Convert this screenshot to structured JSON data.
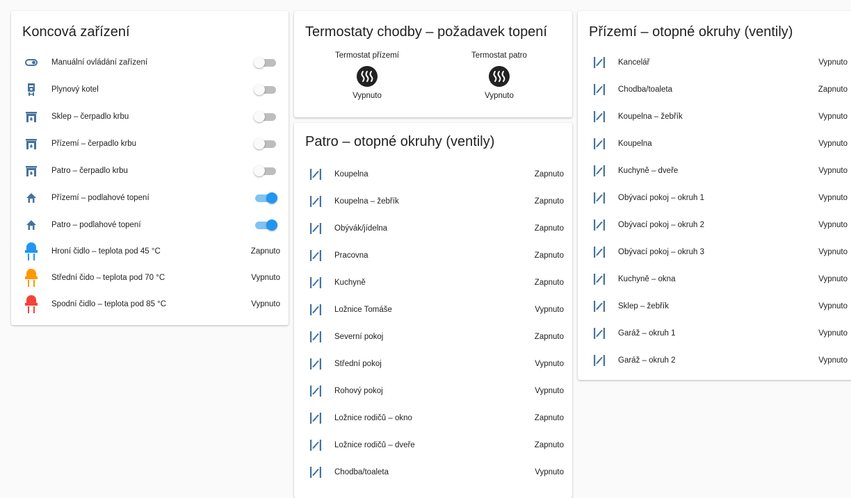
{
  "colors": {
    "icon_blue": "#44739e",
    "toggle_on": "#2196f3",
    "sensor_blue": "#2196f3",
    "sensor_orange": "#ff9800",
    "sensor_red": "#f44336"
  },
  "devices": {
    "title": "Koncová zařízení",
    "items": [
      {
        "label": "Manuální ovládání zařízení",
        "icon": "toggle-switch-icon",
        "type": "toggle",
        "on": false
      },
      {
        "label": "Plynový kotel",
        "icon": "boiler-icon",
        "type": "toggle",
        "on": false
      },
      {
        "label": "Sklep – čerpadlo krbu",
        "icon": "fireplace-icon",
        "type": "toggle",
        "on": false
      },
      {
        "label": "Přízemí – čerpadlo krbu",
        "icon": "fireplace-icon",
        "type": "toggle",
        "on": false
      },
      {
        "label": "Patro – čerpadlo krbu",
        "icon": "fireplace-icon",
        "type": "toggle",
        "on": false
      },
      {
        "label": "Přízemí – podlahové topení",
        "icon": "home-floor-icon",
        "type": "toggle",
        "on": true
      },
      {
        "label": "Patro – podlahové topení",
        "icon": "home-floor-icon",
        "type": "toggle",
        "on": true
      },
      {
        "label": "Hroní čidlo – teplota pod 45 °C",
        "icon": "led-sensor-icon",
        "icon_color": "#2196f3",
        "type": "state",
        "state": "Zapnuto"
      },
      {
        "label": "Střední čido – teplota pod 70 °C",
        "icon": "led-sensor-icon",
        "icon_color": "#ff9800",
        "type": "state",
        "state": "Vypnuto"
      },
      {
        "label": "Spodní čidlo – teplota pod 85 °C",
        "icon": "led-sensor-icon",
        "icon_color": "#f44336",
        "type": "state",
        "state": "Vypnuto"
      }
    ]
  },
  "thermostats": {
    "title": "Termostaty chodby – požadavek topení",
    "items": [
      {
        "name": "Termostat přízemí",
        "state": "Vypnuto"
      },
      {
        "name": "Termostat patro",
        "state": "Vypnuto"
      }
    ]
  },
  "floor_upper": {
    "title": "Patro – otopné okruhy (ventily)",
    "items": [
      {
        "label": "Koupelna",
        "state": "Zapnuto"
      },
      {
        "label": "Koupelna – žebřík",
        "state": "Zapnuto"
      },
      {
        "label": "Obývák/jídelna",
        "state": "Zapnuto"
      },
      {
        "label": "Pracovna",
        "state": "Zapnuto"
      },
      {
        "label": "Kuchyně",
        "state": "Zapnuto"
      },
      {
        "label": "Ložnice Tomáše",
        "state": "Vypnuto"
      },
      {
        "label": "Severní pokoj",
        "state": "Zapnuto"
      },
      {
        "label": "Střední pokoj",
        "state": "Vypnuto"
      },
      {
        "label": "Rohový pokoj",
        "state": "Vypnuto"
      },
      {
        "label": "Ložnice rodičů – okno",
        "state": "Zapnuto"
      },
      {
        "label": "Ložnice rodičů – dveře",
        "state": "Zapnuto"
      },
      {
        "label": "Chodba/toaleta",
        "state": "Vypnuto"
      }
    ]
  },
  "floor_ground": {
    "title": "Přízemí – otopné okruhy (ventily)",
    "items": [
      {
        "label": "Kancelář",
        "state": "Vypnuto"
      },
      {
        "label": "Chodba/toaleta",
        "state": "Zapnuto"
      },
      {
        "label": "Koupelna – žebřík",
        "state": "Vypnuto"
      },
      {
        "label": "Koupelna",
        "state": "Vypnuto"
      },
      {
        "label": "Kuchyně – dveře",
        "state": "Vypnuto"
      },
      {
        "label": "Obývací pokoj – okruh 1",
        "state": "Vypnuto"
      },
      {
        "label": "Obývací pokoj – okruh 2",
        "state": "Vypnuto"
      },
      {
        "label": "Obývací pokoj – okruh 3",
        "state": "Vypnuto"
      },
      {
        "label": "Kuchyně – okna",
        "state": "Vypnuto"
      },
      {
        "label": "Sklep – žebřík",
        "state": "Vypnuto"
      },
      {
        "label": "Garáž – okruh 1",
        "state": "Vypnuto"
      },
      {
        "label": "Garáž – okruh 2",
        "state": "Vypnuto"
      }
    ]
  }
}
